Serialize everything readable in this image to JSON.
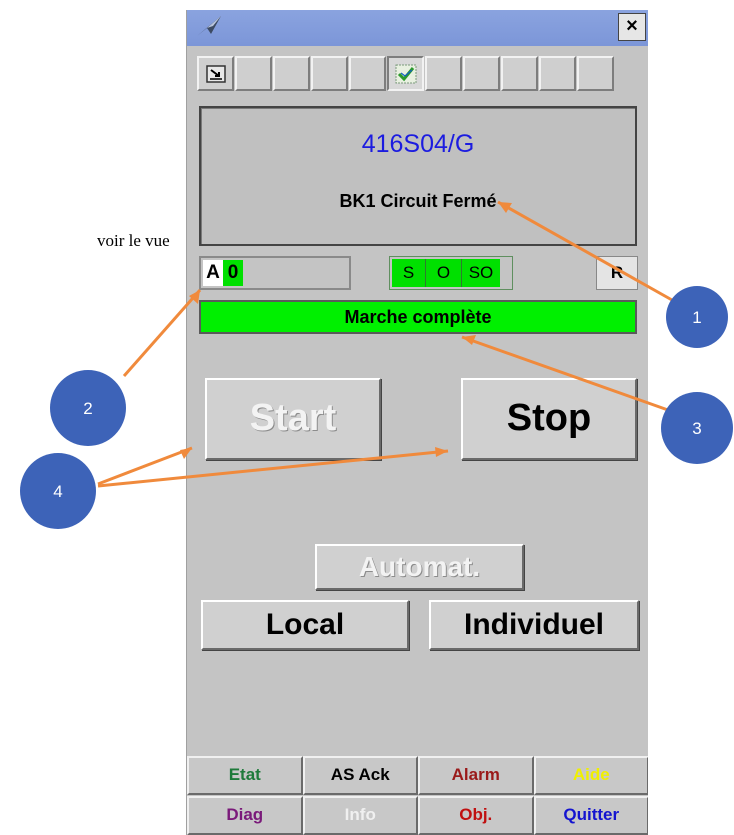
{
  "doc": {
    "partial_text": "voir le vue"
  },
  "window": {
    "close_label": "×"
  },
  "info": {
    "tag": "416S04/G",
    "description": "BK1 Circuit Fermé"
  },
  "mode": {
    "a": "A",
    "value": "0"
  },
  "indicators": {
    "s": "S",
    "o": "O",
    "so": "SO"
  },
  "reset_label": "R",
  "status_text": "Marche complète",
  "buttons": {
    "start": "Start",
    "stop": "Stop",
    "automat": "Automat.",
    "local": "Local",
    "individuel": "Individuel"
  },
  "bottom_buttons": [
    {
      "label": "Etat",
      "color": "#1e7a3a"
    },
    {
      "label": "AS Ack",
      "color": "#000000"
    },
    {
      "label": "Alarm",
      "color": "#9a1a1a"
    },
    {
      "label": "Aide",
      "color": "#f0f000"
    },
    {
      "label": "Diag",
      "color": "#7a1a7a"
    },
    {
      "label": "Info",
      "color": "#f0f0f0"
    },
    {
      "label": "Obj.",
      "color": "#c01010"
    },
    {
      "label": "Quitter",
      "color": "#1414d0"
    }
  ],
  "callouts": [
    "1",
    "2",
    "3",
    "4"
  ],
  "colors": {
    "titlebar": "#7c96d8",
    "panel": "#c4c4c4",
    "status_green": "#00f000",
    "tag_blue": "#1c1ce0",
    "callout_fill": "#3d63b8",
    "arrow": "#f08a3c"
  },
  "icons": [
    "app-logo-icon",
    "close-icon",
    "minimize-icon",
    "checkmark-icon"
  ]
}
